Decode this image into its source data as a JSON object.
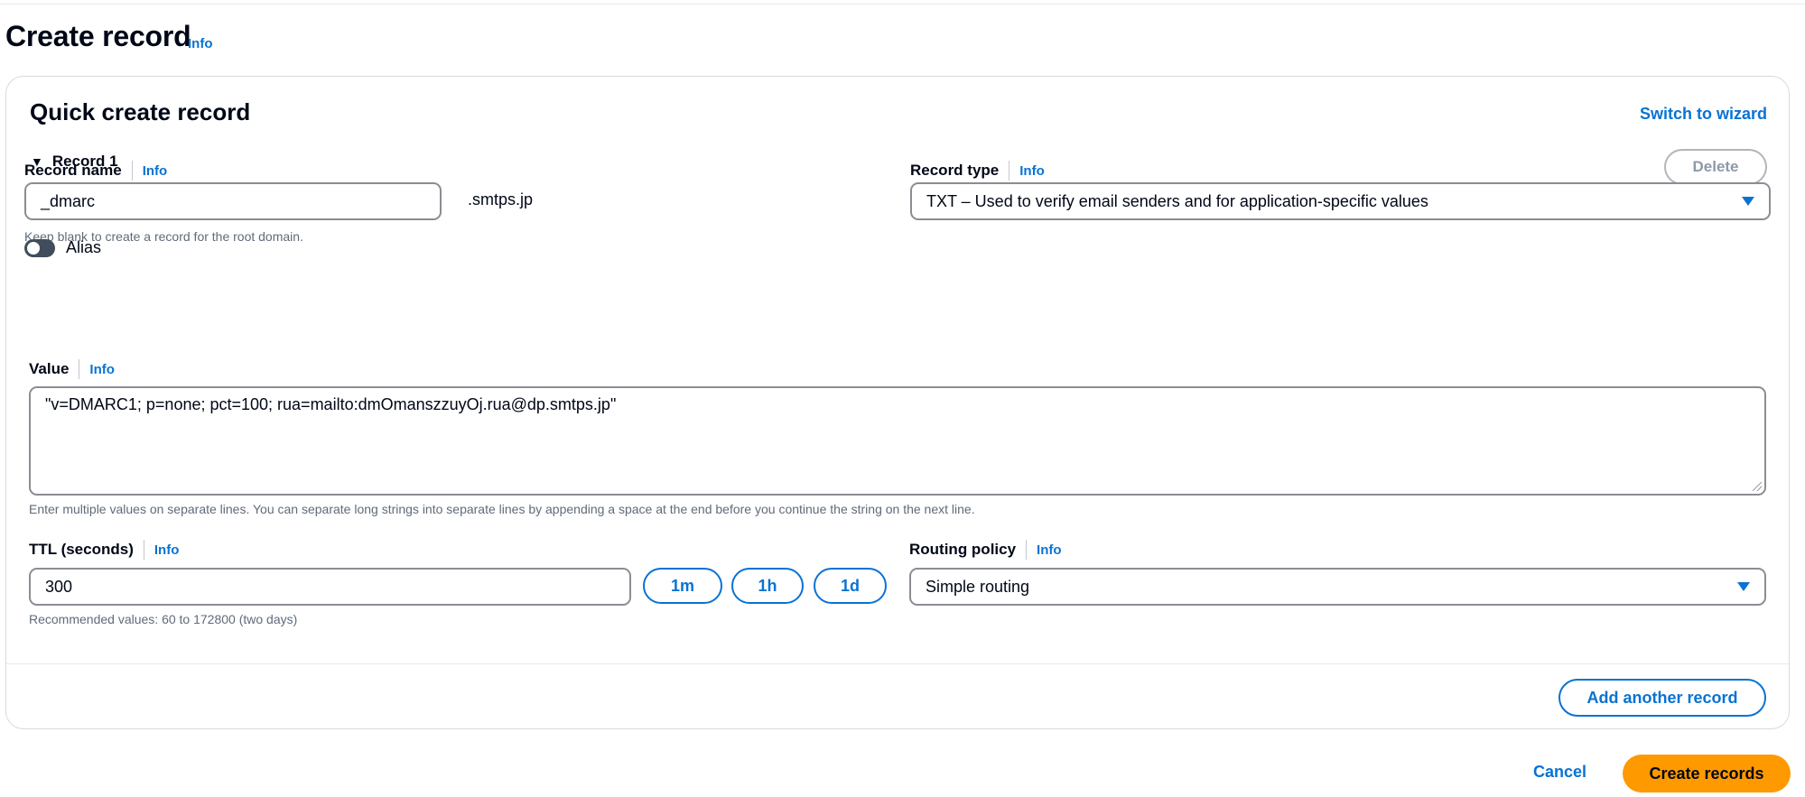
{
  "page": {
    "title": "Create record",
    "info_label": "Info"
  },
  "quick_create": {
    "title": "Quick create record",
    "switch_wizard_label": "Switch to wizard",
    "record_toggle_label": "Record 1",
    "delete_label": "Delete"
  },
  "record_name": {
    "label": "Record name",
    "info_label": "Info",
    "value": "_dmarc",
    "suffix": ".smtps.jp",
    "hint": "Keep blank to create a record for the root domain."
  },
  "record_type": {
    "label": "Record type",
    "info_label": "Info",
    "selected": "TXT – Used to verify email senders and for application-specific values"
  },
  "alias": {
    "label": "Alias",
    "enabled": false
  },
  "value_field": {
    "label": "Value",
    "info_label": "Info",
    "value": "\"v=DMARC1; p=none; pct=100; rua=mailto:dmOmanszzuyOj.rua@dp.smtps.jp\"",
    "hint": "Enter multiple values on separate lines. You can separate long strings into separate lines by appending a space at the end before you continue the string on the next line."
  },
  "ttl": {
    "label": "TTL (seconds)",
    "info_label": "Info",
    "value": "300",
    "presets": [
      "1m",
      "1h",
      "1d"
    ],
    "hint": "Recommended values: 60 to 172800 (two days)"
  },
  "routing_policy": {
    "label": "Routing policy",
    "info_label": "Info",
    "selected": "Simple routing"
  },
  "footer": {
    "add_another_label": "Add another record",
    "cancel_label": "Cancel",
    "create_label": "Create records"
  },
  "colors": {
    "link": "#0972d3",
    "primary_button": "#ff9900",
    "toggle_off": "#414d5c"
  }
}
